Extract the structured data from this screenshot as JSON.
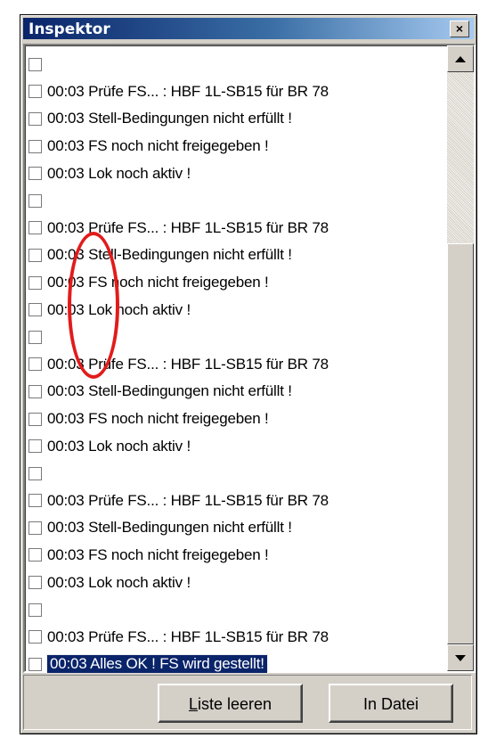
{
  "window": {
    "title": "Inspektor",
    "close_label": "×"
  },
  "list": {
    "rows": [
      {
        "text": "",
        "selected": false
      },
      {
        "text": "00:03 Prüfe FS... : HBF 1L-SB15 für BR 78",
        "selected": false
      },
      {
        "text": "00:03 Stell-Bedingungen nicht erfüllt !",
        "selected": false
      },
      {
        "text": "00:03 FS noch nicht freigegeben !",
        "selected": false
      },
      {
        "text": "00:03 Lok noch aktiv !",
        "selected": false
      },
      {
        "text": "",
        "selected": false
      },
      {
        "text": "00:03 Prüfe FS... : HBF 1L-SB15 für BR 78",
        "selected": false
      },
      {
        "text": "00:03 Stell-Bedingungen nicht erfüllt !",
        "selected": false
      },
      {
        "text": "00:03 FS noch nicht freigegeben !",
        "selected": false
      },
      {
        "text": "00:03 Lok noch aktiv !",
        "selected": false
      },
      {
        "text": "",
        "selected": false
      },
      {
        "text": "00:03 Prüfe FS... : HBF 1L-SB15 für BR 78",
        "selected": false
      },
      {
        "text": "00:03 Stell-Bedingungen nicht erfüllt !",
        "selected": false
      },
      {
        "text": "00:03 FS noch nicht freigegeben !",
        "selected": false
      },
      {
        "text": "00:03 Lok noch aktiv !",
        "selected": false
      },
      {
        "text": "",
        "selected": false
      },
      {
        "text": "00:03 Prüfe FS... : HBF 1L-SB15 für BR 78",
        "selected": false
      },
      {
        "text": "00:03 Stell-Bedingungen nicht erfüllt !",
        "selected": false
      },
      {
        "text": "00:03 FS noch nicht freigegeben !",
        "selected": false
      },
      {
        "text": "00:03 Lok noch aktiv !",
        "selected": false
      },
      {
        "text": "",
        "selected": false
      },
      {
        "text": "00:03 Prüfe FS... : HBF 1L-SB15 für BR 78",
        "selected": false
      },
      {
        "text": "00:03 Alles OK ! FS wird gestellt!",
        "selected": true
      }
    ]
  },
  "buttons": {
    "clear_accel": "L",
    "clear_rest": "iste leeren",
    "file": "In Datei"
  },
  "colors": {
    "title_bar": "#0a246a",
    "selection": "#0a246a",
    "annotation": "#e21b1b"
  },
  "icons": {
    "scroll_up": "arrow-up-icon",
    "scroll_down": "arrow-down-icon",
    "close": "close-icon"
  }
}
